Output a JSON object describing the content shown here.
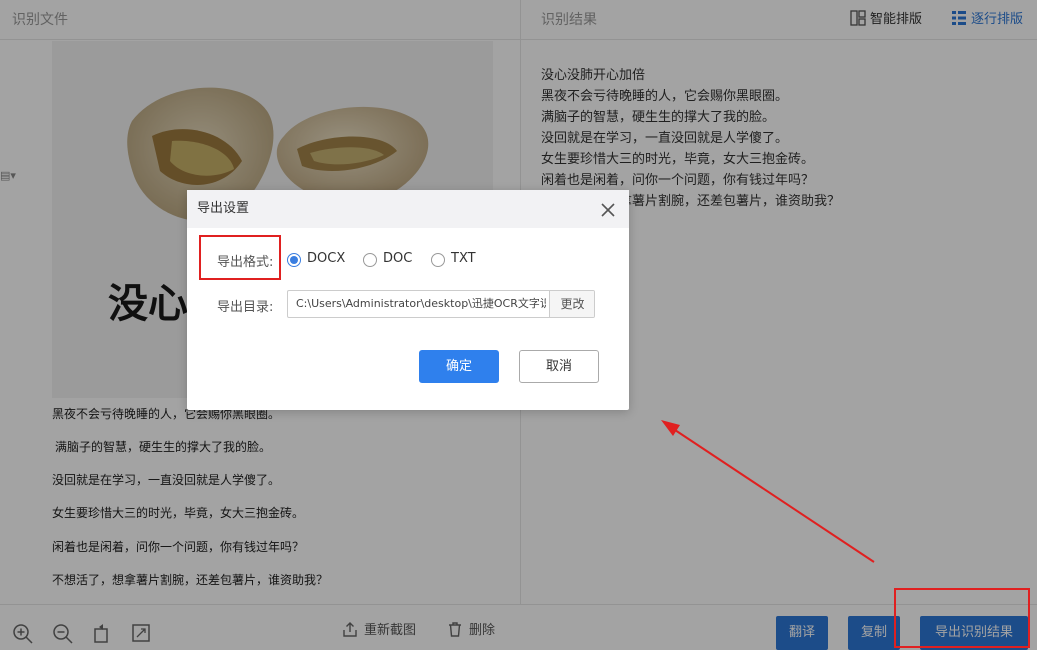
{
  "left_panel": {
    "title": "识别文件"
  },
  "right_panel": {
    "title": "识别结果",
    "smart_layout": "智能排版",
    "line_layout": "逐行排版",
    "lines": [
      "没心没肺开心加倍",
      "黑夜不会亏待晚睡的人，它会赐你黑眼圈。",
      "满脑子的智慧，硬生生的撑大了我的脸。",
      "没回就是在学习，一直没回就是人学傻了。",
      "女生要珍惜大三的时光，毕竟，女大三抱金砖。",
      "闲着也是闲着，问你一个问题，你有钱过年吗？",
      "不想活了，想拿薯片割腕，还差包薯片，谁资助我？"
    ]
  },
  "image_text": {
    "title": "没心没肺开心加倍",
    "lines": [
      "黑夜不会亏待晚睡的人，它会赐你黑眼圈。",
      "满脑子的智慧，硬生生的撑大了我的脸。",
      "没回就是在学习，一直没回就是人学傻了。",
      "女生要珍惜大三的时光，毕竟，女大三抱金砖。",
      "闲着也是闲着，问你一个问题，你有钱过年吗？",
      "不想活了，想拿薯片割腕，还差包薯片，谁资助我？"
    ]
  },
  "toolbar": {
    "recapture": "重新截图",
    "delete": "删除",
    "translate": "翻译",
    "copy": "复制",
    "export": "导出识别结果"
  },
  "dialog": {
    "title": "导出设置",
    "format_label": "导出格式:",
    "formats": [
      "DOCX",
      "DOC",
      "TXT"
    ],
    "selected_format": "DOCX",
    "dir_label": "导出目录:",
    "dir_value": "C:\\Users\\Administrator\\desktop\\迅捷OCR文字识别",
    "change": "更改",
    "ok": "确定",
    "cancel": "取消"
  },
  "colors": {
    "accent": "#2d78d7",
    "annotation": "#e02020"
  }
}
